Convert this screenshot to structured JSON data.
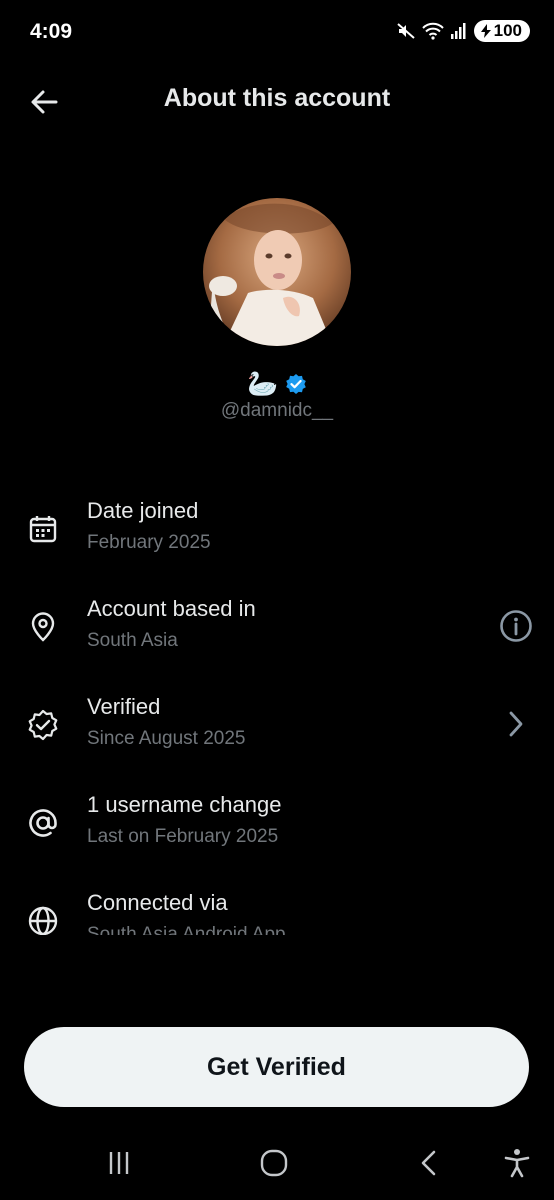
{
  "status_bar": {
    "time": "4:09",
    "battery": "100"
  },
  "header": {
    "title": "About this account"
  },
  "profile": {
    "name_emoji": "🦢",
    "handle": "@damnidc__",
    "verified_color": "#1d9bf0"
  },
  "items": [
    {
      "icon": "calendar-icon",
      "title": "Date joined",
      "subtitle": "February 2025"
    },
    {
      "icon": "location-pin-icon",
      "title": "Account based in",
      "subtitle": "South Asia",
      "trailing": "info-icon"
    },
    {
      "icon": "verified-badge-icon",
      "title": "Verified",
      "subtitle": "Since August 2025",
      "trailing": "chevron-right-icon"
    },
    {
      "icon": "at-sign-icon",
      "title": "1 username change",
      "subtitle": "Last on February 2025"
    },
    {
      "icon": "globe-icon",
      "title": "Connected via",
      "subtitle": "South Asia Android App"
    }
  ],
  "cta": {
    "label": "Get Verified"
  },
  "colors": {
    "background": "#000000",
    "text_primary": "#e7e9ea",
    "text_secondary": "#71767b",
    "button_bg": "#eff3f4",
    "accent": "#1d9bf0"
  }
}
